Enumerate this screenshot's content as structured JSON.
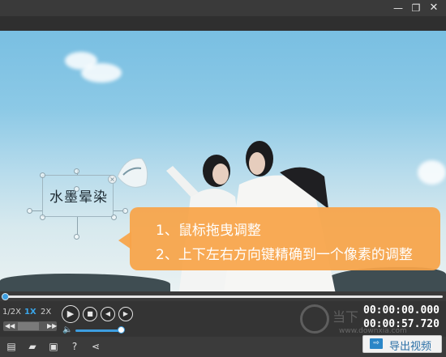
{
  "window": {
    "controls": {
      "minimize_icon": "minimize-icon",
      "restore_icon": "restore-icon",
      "close_icon": "close-icon"
    }
  },
  "video": {
    "overlay_text": "水墨晕染",
    "close_glyph": "×",
    "callout": {
      "line1": "1、鼠标拖曳调整",
      "line2": "2、上下左右方向键精确到一个像素的调整"
    }
  },
  "timeline": {
    "progress": 0.0
  },
  "controls": {
    "speeds": [
      "1/2X",
      "1X",
      "2X"
    ],
    "selected_speed": "1X",
    "frame_back_glyph": "◀◀",
    "frame_forward_glyph": "▶▶",
    "play_glyph": "▶",
    "stop_glyph": "■",
    "prev_glyph": "◀",
    "next_glyph": "▶",
    "volume_glyph": "🔈",
    "volume_level": 0.9,
    "time_current": "00:00:00.000",
    "time_total": "00:00:57.720"
  },
  "watermark": {
    "text": "当下",
    "url": "www.downxia.com"
  },
  "toolbar": {
    "icons": [
      "document-icon",
      "folder-open-icon",
      "save-icon",
      "help-icon",
      "share-icon"
    ],
    "glyphs": {
      "doc": "▤",
      "folder": "▰",
      "save": "▣",
      "help": "?",
      "share": "⋖"
    },
    "export_label": "导出视频",
    "export_glyph": "⇨"
  },
  "colors": {
    "accent": "#3d9ee0",
    "callout": "#f7a448"
  }
}
